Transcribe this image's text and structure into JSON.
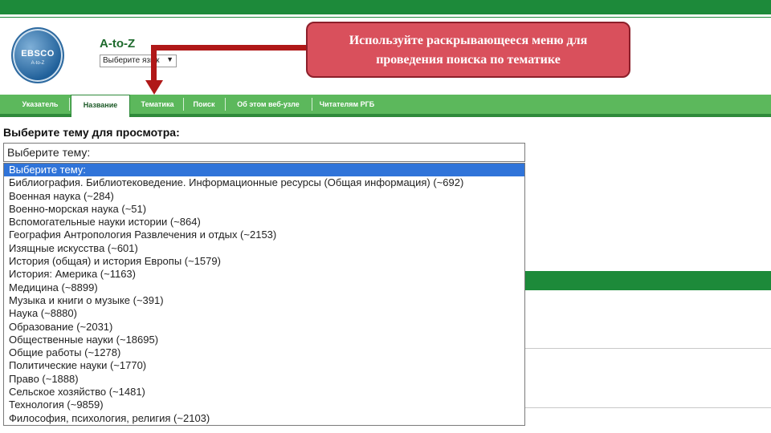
{
  "header": {
    "logo_text": "EBSCO",
    "logo_sub": "A-to-Z",
    "title": "A-to-Z",
    "language_select": "Выберите язык"
  },
  "callout": {
    "line1": "Используйте раскрывающееся меню для",
    "line2": "проведения поиска по тематике"
  },
  "nav": {
    "items": [
      {
        "label": "Указатель"
      },
      {
        "label": "Название"
      },
      {
        "label": "Тематика"
      },
      {
        "label": "Поиск"
      },
      {
        "label": "Об этом веб-узле"
      },
      {
        "label": "Читателям РГБ"
      }
    ],
    "active": "Название"
  },
  "main": {
    "prompt": "Выберите тему для просмотра:",
    "dropdown_value": "Выберите тему:",
    "options": [
      "Выберите тему:",
      "Библиография. Библиотековедение. Информационные ресурсы (Общая информация) (~692)",
      "Военная наука (~284)",
      "Военно-морская наука (~51)",
      "Вспомогательные науки истории (~864)",
      "География Антропология Развлечения и отдых (~2153)",
      "Изящные искусства (~601)",
      "История (общая) и история Европы (~1579)",
      "История: Америка (~1163)",
      "Медицина (~8899)",
      "Музыка и книги о музыке (~391)",
      "Наука (~8880)",
      "Образование (~2031)",
      "Общественные науки (~18695)",
      "Общие работы (~1278)",
      "Политические науки (~1770)",
      "Право (~1888)",
      "Сельское хозяйство (~1481)",
      "Технология (~9859)",
      "Философия, психология, религия (~2103)"
    ]
  },
  "colors": {
    "brand_green": "#1d8a3a",
    "nav_green": "#5cb85c",
    "callout_red": "#d9505c",
    "arrow_red": "#b01818",
    "selection_blue": "#3074d9"
  }
}
